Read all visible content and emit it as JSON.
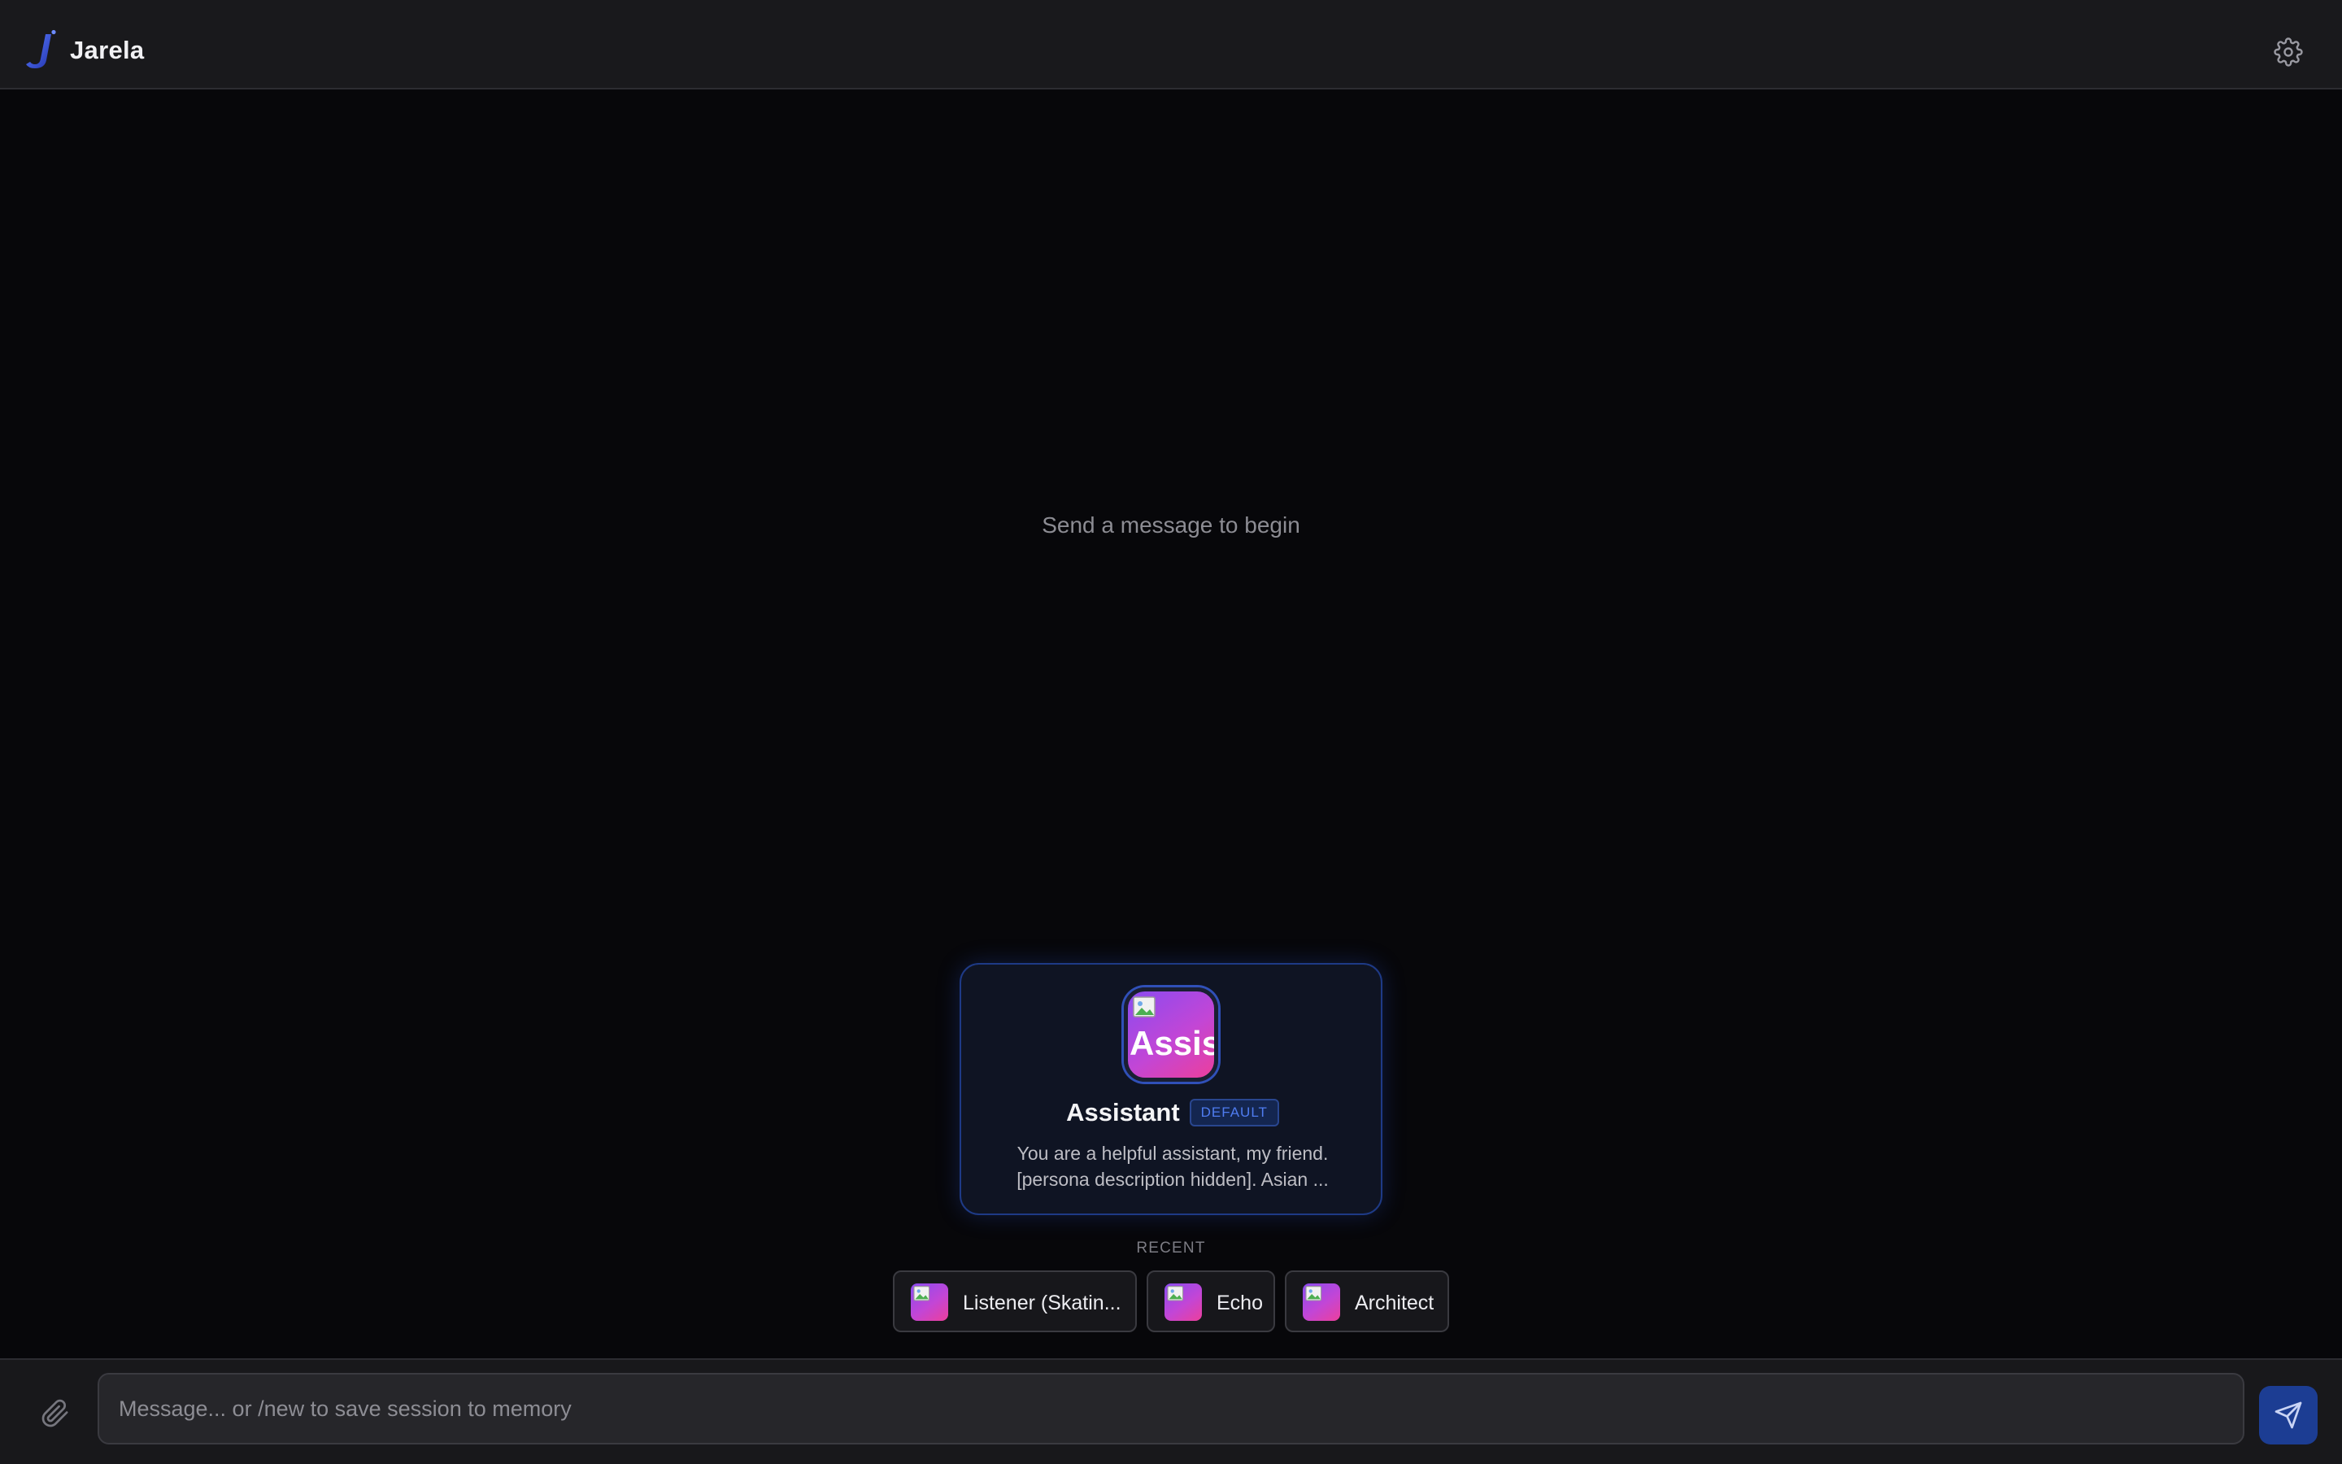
{
  "header": {
    "logo_icon": "jarela-logo-icon",
    "app_title": "Jarela",
    "settings_icon": "gear-icon"
  },
  "chat": {
    "empty_message": "Send a message to begin"
  },
  "active_persona": {
    "avatar_alt_text": "Assistant",
    "name": "Assistant",
    "badge": "DEFAULT",
    "description_line1": "You are a helpful assistant, my friend.",
    "description_line2": "[persona description hidden]. Asian ..."
  },
  "recent": {
    "label": "RECENT",
    "items": [
      {
        "name": "Listener (Skatin..."
      },
      {
        "name": "Echo"
      },
      {
        "name": "Architect"
      }
    ]
  },
  "composer": {
    "attach_icon": "paperclip-icon",
    "placeholder": "Message... or /new to save session to memory",
    "value": "",
    "send_icon": "send-icon"
  },
  "colors": {
    "accent": "#1c3d93",
    "badge_text": "#4f7cf0",
    "avatar_gradient_start": "#8a4bf0",
    "avatar_gradient_end": "#ec3f9c",
    "background": "#07070a",
    "header_background": "#19191c"
  }
}
